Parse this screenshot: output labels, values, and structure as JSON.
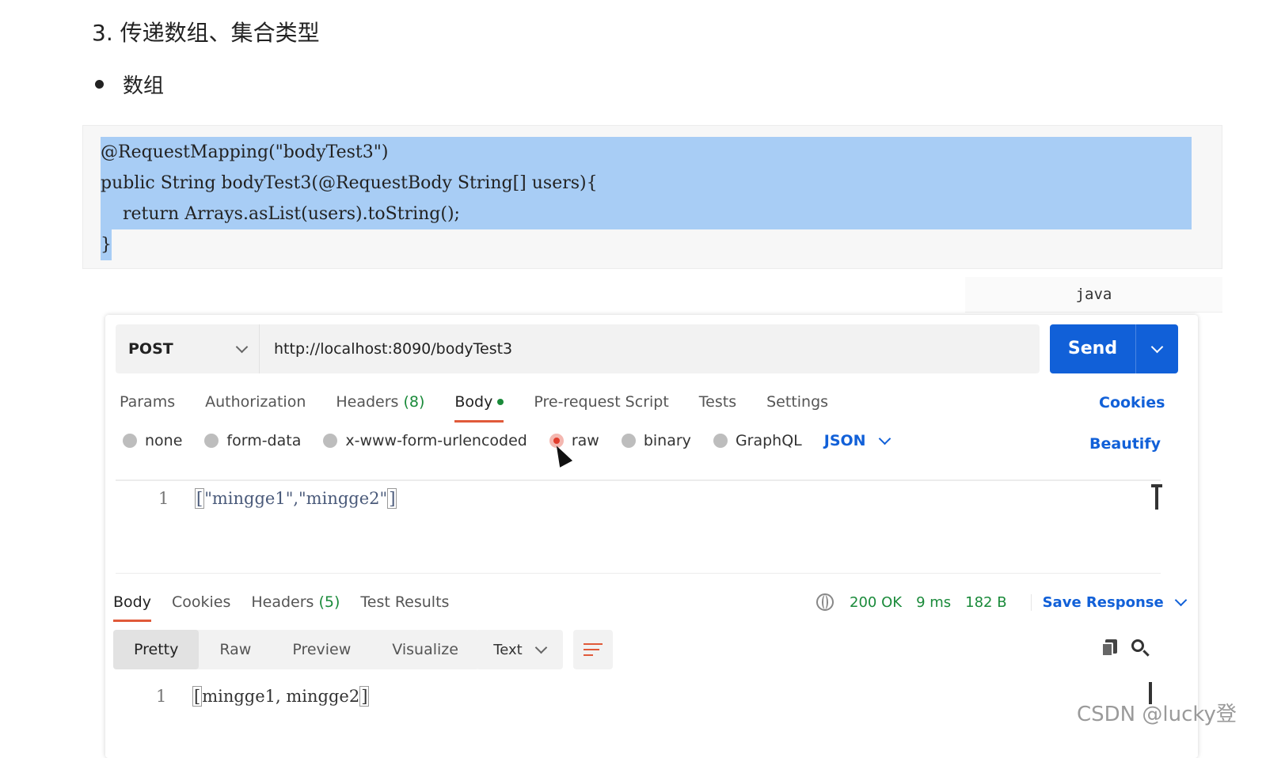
{
  "heading": "3. 传递数组、集合类型",
  "bullet": "数组",
  "code": {
    "lines": [
      "@RequestMapping(\"bodyTest3\")",
      "public String bodyTest3(@RequestBody String[] users){",
      "    return Arrays.asList(users).toString();",
      "}"
    ],
    "language": "java"
  },
  "request": {
    "method": "POST",
    "url": "http://localhost:8090/bodyTest3",
    "send_label": "Send"
  },
  "tabs": {
    "params": "Params",
    "authorization": "Authorization",
    "headers": "Headers",
    "headers_count": "(8)",
    "body": "Body",
    "pre_request": "Pre-request Script",
    "tests": "Tests",
    "settings": "Settings",
    "cookies": "Cookies"
  },
  "body_types": {
    "none": "none",
    "form_data": "form-data",
    "urlencoded": "x-www-form-urlencoded",
    "raw": "raw",
    "binary": "binary",
    "graphql": "GraphQL",
    "format": "JSON",
    "beautify": "Beautify",
    "selected": "raw"
  },
  "editor": {
    "line_number": "1",
    "open_bracket": "[",
    "content": "\"mingge1\",\"mingge2\"",
    "close_bracket": "]"
  },
  "response": {
    "tabs": {
      "body": "Body",
      "cookies": "Cookies",
      "headers": "Headers",
      "headers_count": "(5)",
      "test_results": "Test Results"
    },
    "status": "200 OK",
    "time": "9 ms",
    "size": "182 B",
    "save_response": "Save Response",
    "views": {
      "pretty": "Pretty",
      "raw": "Raw",
      "preview": "Preview",
      "visualize": "Visualize"
    },
    "format": "Text",
    "line_number": "1",
    "open_bracket": "[",
    "content": "mingge1, mingge2",
    "close_bracket": "]"
  },
  "watermark": "CSDN @lucky登"
}
